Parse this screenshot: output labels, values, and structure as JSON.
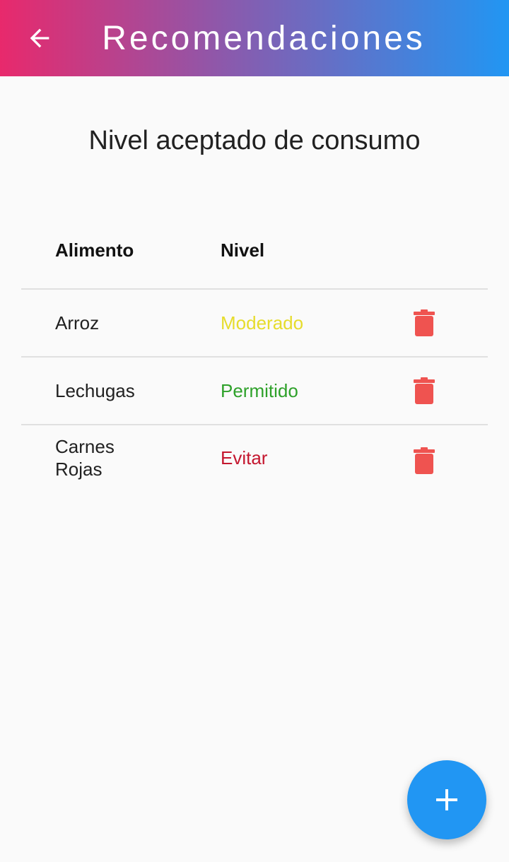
{
  "appbar": {
    "title": "Recomendaciones",
    "back_icon": "arrow-back-icon"
  },
  "page": {
    "heading": "Nivel aceptado de consumo"
  },
  "table": {
    "headers": {
      "food": "Alimento",
      "level": "Nivel"
    },
    "rows": [
      {
        "food": "Arroz",
        "level": "Moderado",
        "level_color": "#e6dc2c",
        "action_icon": "trash-icon"
      },
      {
        "food": "Lechugas",
        "level": "Permitido",
        "level_color": "#2ea12a",
        "action_icon": "trash-icon"
      },
      {
        "food": "Carnes Rojas",
        "level": "Evitar",
        "level_color": "#c4172f",
        "action_icon": "trash-icon"
      }
    ]
  },
  "fab": {
    "icon": "plus-icon"
  },
  "colors": {
    "gradient_start": "#e8296c",
    "gradient_end": "#2196f3",
    "delete": "#ef5350",
    "fab": "#2196f3"
  }
}
